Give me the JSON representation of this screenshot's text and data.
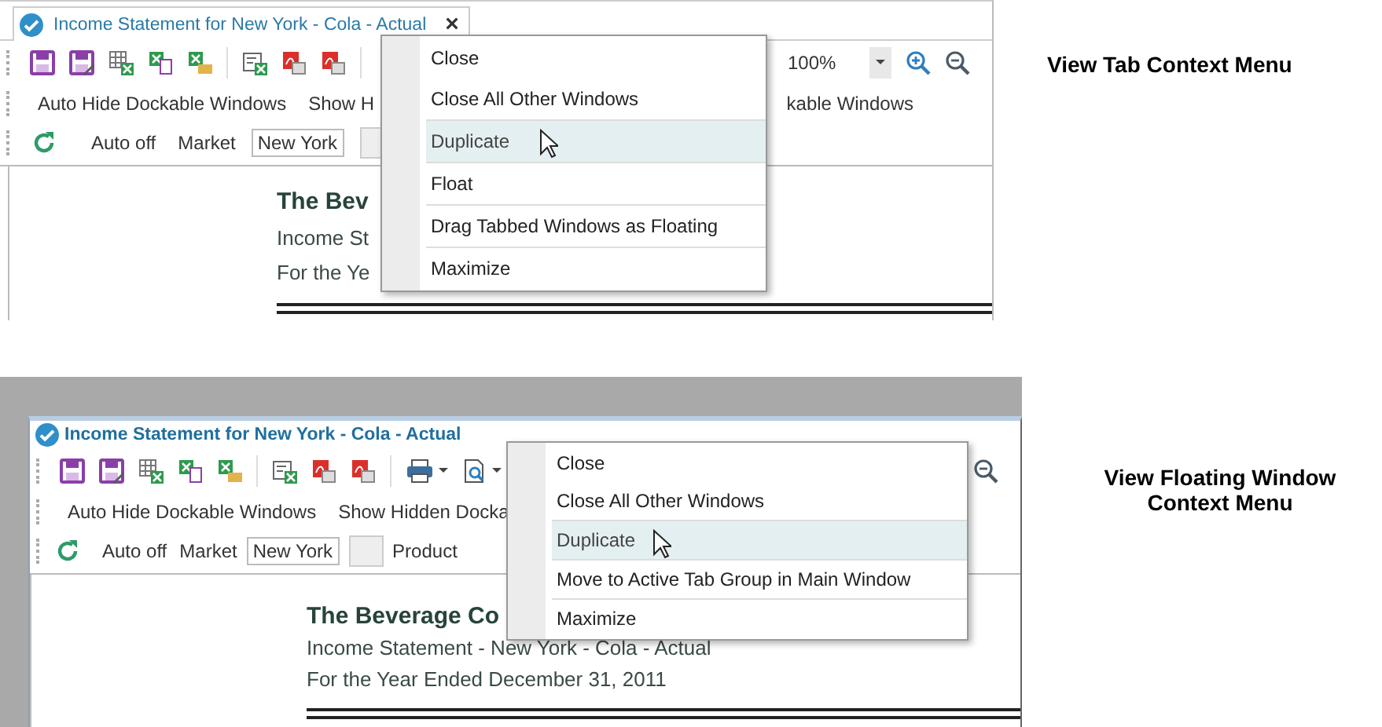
{
  "panels": [
    {
      "kind": "docked",
      "title": "Income Statement for New York - Cola - Actual",
      "close_glyph": "×",
      "zoom": "100%",
      "commands": [
        "Auto Hide Dockable Windows",
        "Show H",
        "kable Windows"
      ],
      "auto": "Auto off",
      "market_label": "Market",
      "market_value": "New York",
      "document": {
        "title": "The Bev",
        "lines": [
          "Income St",
          "For the Ye"
        ]
      },
      "menu": {
        "items": [
          {
            "label": "Close",
            "selected": false,
            "separator_above": false
          },
          {
            "label": "Close All Other Windows",
            "selected": false,
            "separator_above": false
          },
          {
            "label": "Duplicate",
            "selected": true,
            "separator_above": true
          },
          {
            "label": "Float",
            "selected": false,
            "separator_above": true
          },
          {
            "label": "Drag Tabbed Windows as Floating",
            "selected": false,
            "separator_above": true
          },
          {
            "label": "Maximize",
            "selected": false,
            "separator_above": true
          }
        ]
      },
      "caption": "View Tab Context Menu"
    },
    {
      "kind": "floating",
      "title": "Income Statement for New York - Cola - Actual",
      "commands": [
        "Auto Hide Dockable Windows",
        "Show Hidden Docka"
      ],
      "auto": "Auto off",
      "market_label": "Market",
      "market_value": "New York",
      "product_label": "Product",
      "document": {
        "title": "The Beverage Co",
        "lines": [
          "Income Statement - New York - Cola - Actual",
          "For the Year Ended December 31, 2011"
        ]
      },
      "menu": {
        "items": [
          {
            "label": "Close",
            "selected": false,
            "separator_above": false
          },
          {
            "label": "Close All Other Windows",
            "selected": false,
            "separator_above": false
          },
          {
            "label": "Duplicate",
            "selected": true,
            "separator_above": true
          },
          {
            "label": "Move to Active Tab Group in Main Window",
            "selected": false,
            "separator_above": true
          },
          {
            "label": "Maximize",
            "selected": false,
            "separator_above": true
          }
        ]
      },
      "caption": "View Floating Window Context Menu"
    }
  ]
}
